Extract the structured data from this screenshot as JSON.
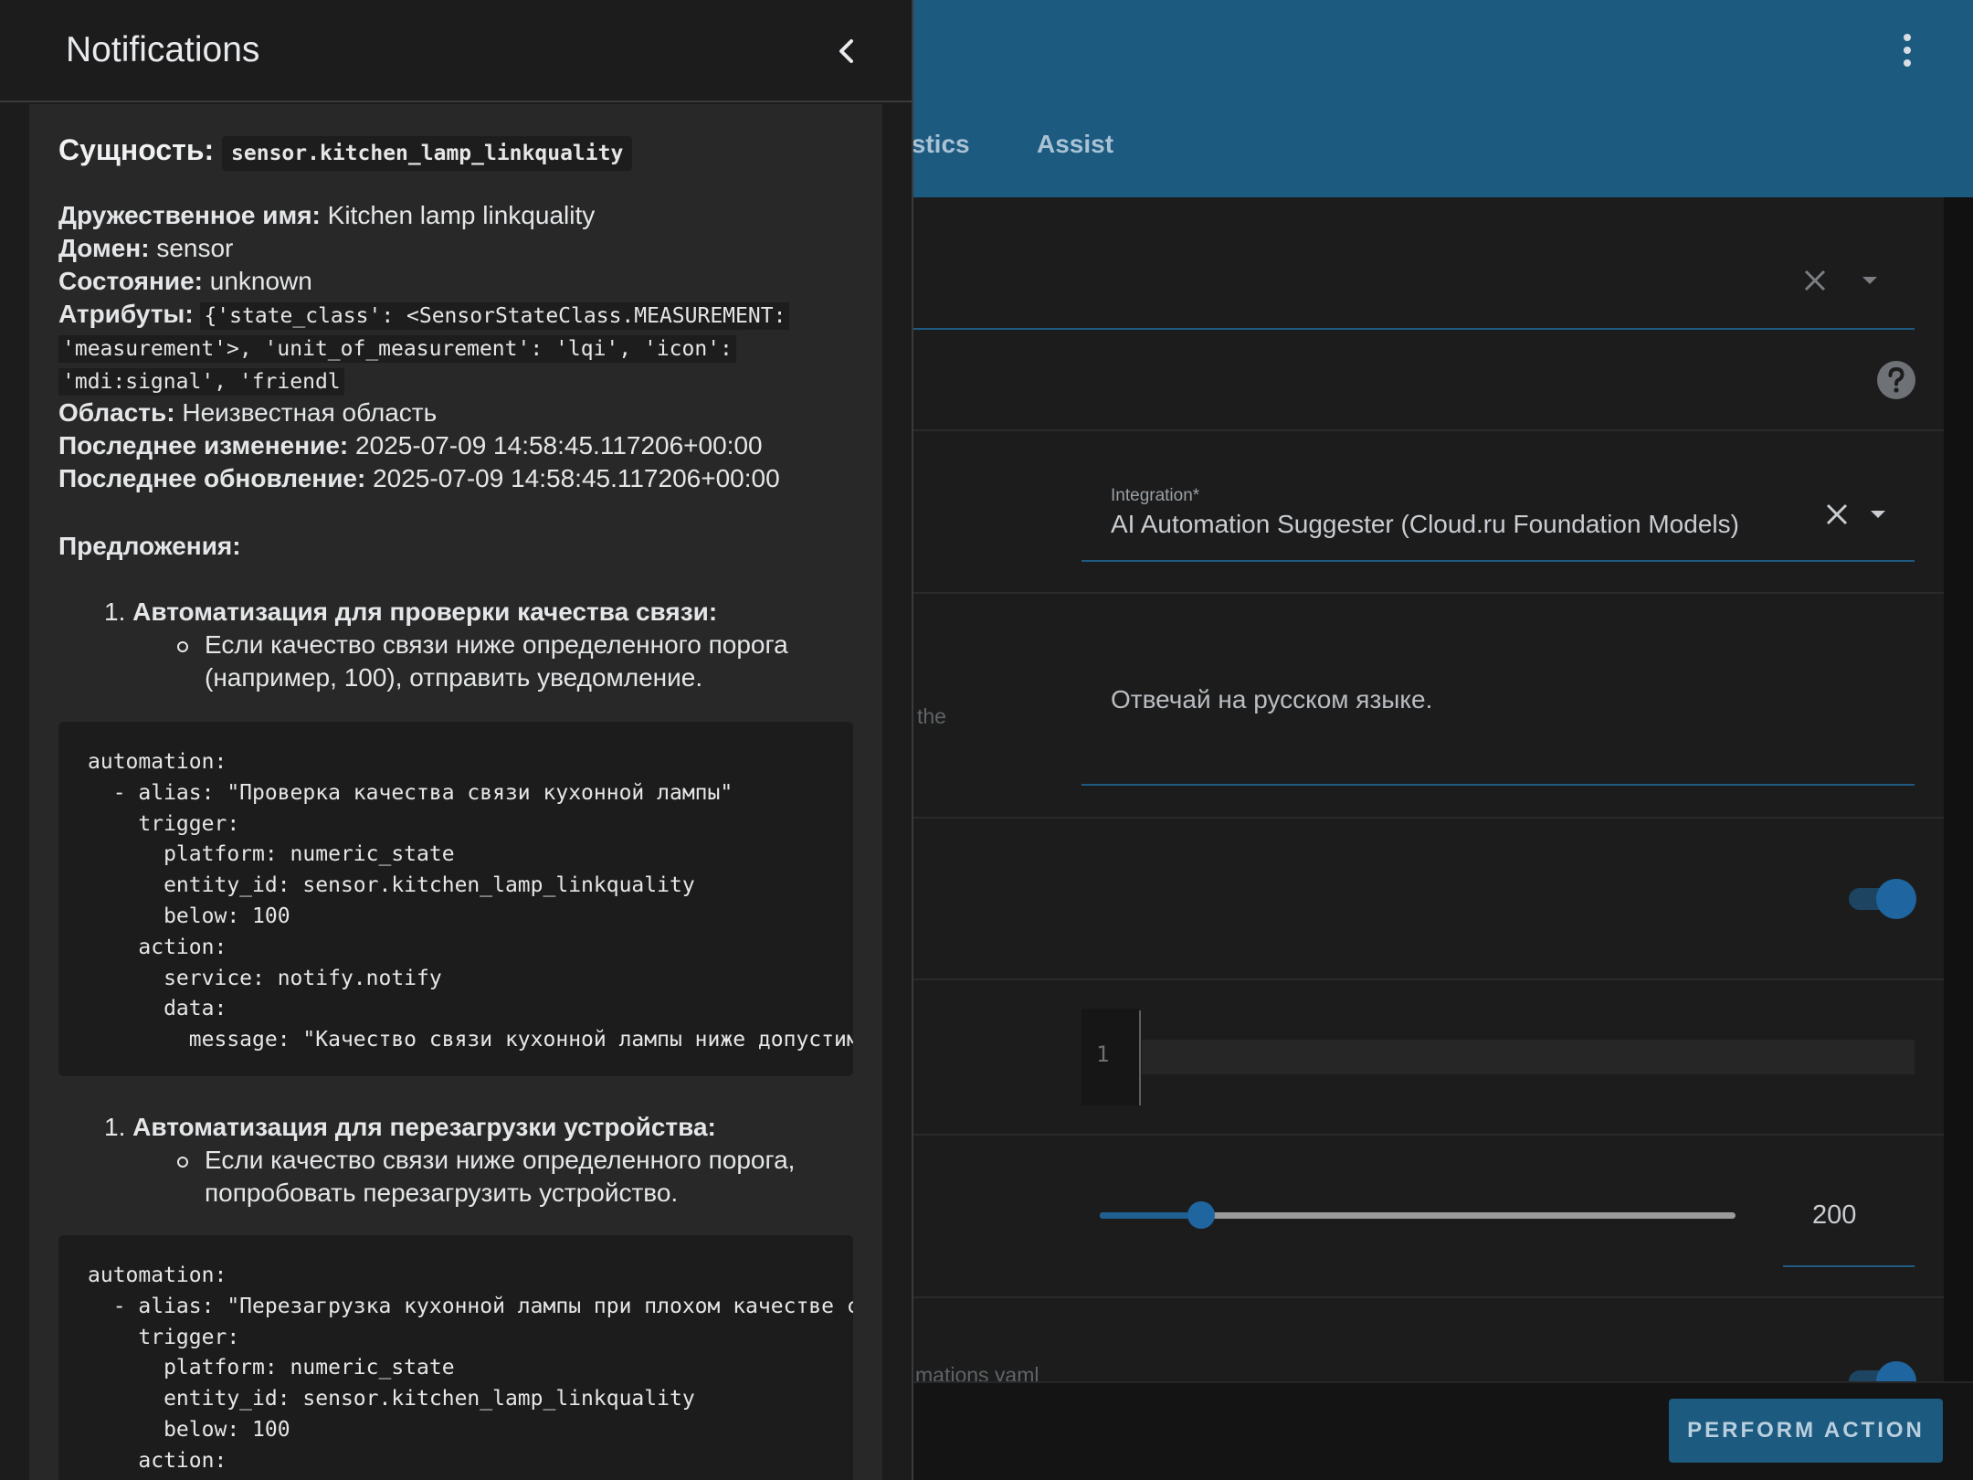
{
  "app": {
    "tabs": [
      "istics",
      "Assist"
    ],
    "integration_label": "Integration*",
    "integration_value": "AI Automation Suggester (Cloud.ru Foundation Models)",
    "prompt_value": "Отвечай на русском языке.",
    "fragment_the": "the",
    "fragment_yaml": "mations yaml",
    "code_line_number": "1",
    "slider": {
      "value": 200,
      "fraction": 0.16,
      "value_label": "200"
    },
    "toggle_on": true,
    "perform_button": "PERFORM ACTION",
    "colors": {
      "header": "#1c5a80",
      "accent": "#1f66a0"
    }
  },
  "drawer": {
    "title": "Notifications",
    "back_icon": "chevron-left-icon",
    "entity_label": "Сущность:",
    "entity_id": "sensor.kitchen_lamp_linkquality",
    "friendly_label": "Дружественное имя:",
    "friendly_value": " Kitchen lamp linkquality",
    "domain_label": "Домен:",
    "domain_value": " sensor",
    "state_label": "Состояние:",
    "state_value": " unknown",
    "attrs_label": "Атрибуты:",
    "attrs_line1": "{'state_class': <SensorStateClass.MEASUREMENT:",
    "attrs_line2": "'measurement'>, 'unit_of_measurement': 'lqi', 'icon':",
    "attrs_line3": "'mdi:signal', 'friendl",
    "area_label": "Область:",
    "area_value": " Неизвестная область",
    "changed_label": "Последнее изменение:",
    "changed_value": " 2025-07-09 14:58:45.117206+00:00",
    "updated_label": "Последнее обновление:",
    "updated_value": " 2025-07-09 14:58:45.117206+00:00",
    "suggestions_label": "Предложения:",
    "suggestion1_number": "1.",
    "suggestion1_title": "Автоматизация для проверки качества связи:",
    "suggestion1_line1": "Если качество связи ниже определенного порога",
    "suggestion1_line2": "(например, 100), отправить уведомление.",
    "code1": "automation:\n  - alias: \"Проверка качества связи кухонной лампы\"\n    trigger:\n      platform: numeric_state\n      entity_id: sensor.kitchen_lamp_linkquality\n      below: 100\n    action:\n      service: notify.notify\n      data:\n        message: \"Качество связи кухонной лампы ниже допустимого уровня\"",
    "suggestion2_number": "1.",
    "suggestion2_title": "Автоматизация для перезагрузки устройства:",
    "suggestion2_line1": "Если качество связи ниже определенного порога,",
    "suggestion2_line2": "попробовать перезагрузить устройство.",
    "code2": "automation:\n  - alias: \"Перезагрузка кухонной лампы при плохом качестве связи\"\n    trigger:\n      platform: numeric_state\n      entity_id: sensor.kitchen_lamp_linkquality\n      below: 100\n    action:"
  }
}
